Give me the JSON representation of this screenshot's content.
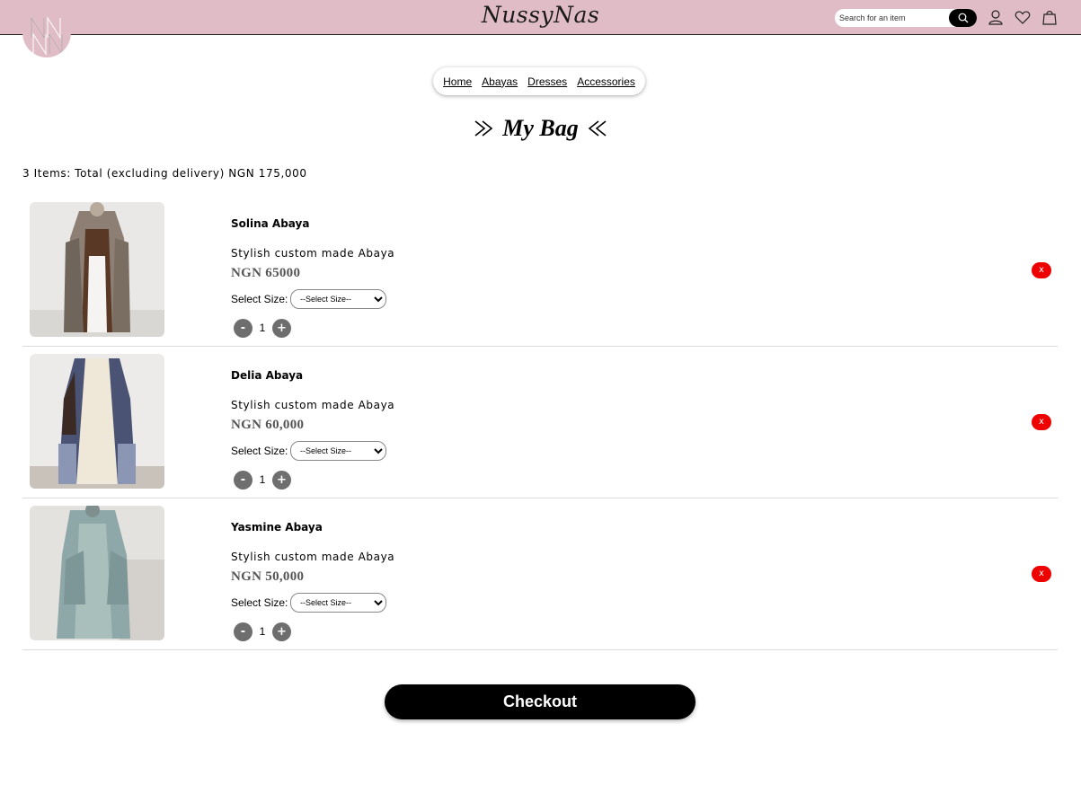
{
  "header": {
    "brand": "NussyNas",
    "search_placeholder": "Search for an item",
    "icons": [
      "search-icon",
      "user-icon",
      "heart-icon",
      "bag-icon"
    ],
    "color": "#e0bcc7"
  },
  "nav": {
    "links": [
      "Home",
      "Abayas",
      "Dresses",
      "Accessories"
    ]
  },
  "page": {
    "title": "My Bag",
    "summary": "3 Items: Total (excluding delivery) NGN 175,000"
  },
  "items": [
    {
      "name": "Solina Abaya",
      "description": "Stylish custom made Abaya",
      "price": "NGN 65000",
      "size_label": "Select Size:",
      "size_selected": "--Select Size--",
      "quantity": "1",
      "decrease_label": "-",
      "increase_label": "+",
      "remove_label": "x"
    },
    {
      "name": "Delia Abaya",
      "description": "Stylish custom made Abaya",
      "price": "NGN 60,000",
      "size_label": "Select Size:",
      "size_selected": "--Select Size--",
      "quantity": "1",
      "decrease_label": "-",
      "increase_label": "+",
      "remove_label": "x"
    },
    {
      "name": "Yasmine Abaya",
      "description": "Stylish custom made Abaya",
      "price": "NGN 50,000",
      "size_label": "Select Size:",
      "size_selected": "--Select Size--",
      "quantity": "1",
      "decrease_label": "-",
      "increase_label": "+",
      "remove_label": "x"
    }
  ],
  "checkout": {
    "label": "Checkout"
  },
  "colors": {
    "accent": "#e0bcc7",
    "remove": "#ee0000",
    "button": "#000000"
  }
}
